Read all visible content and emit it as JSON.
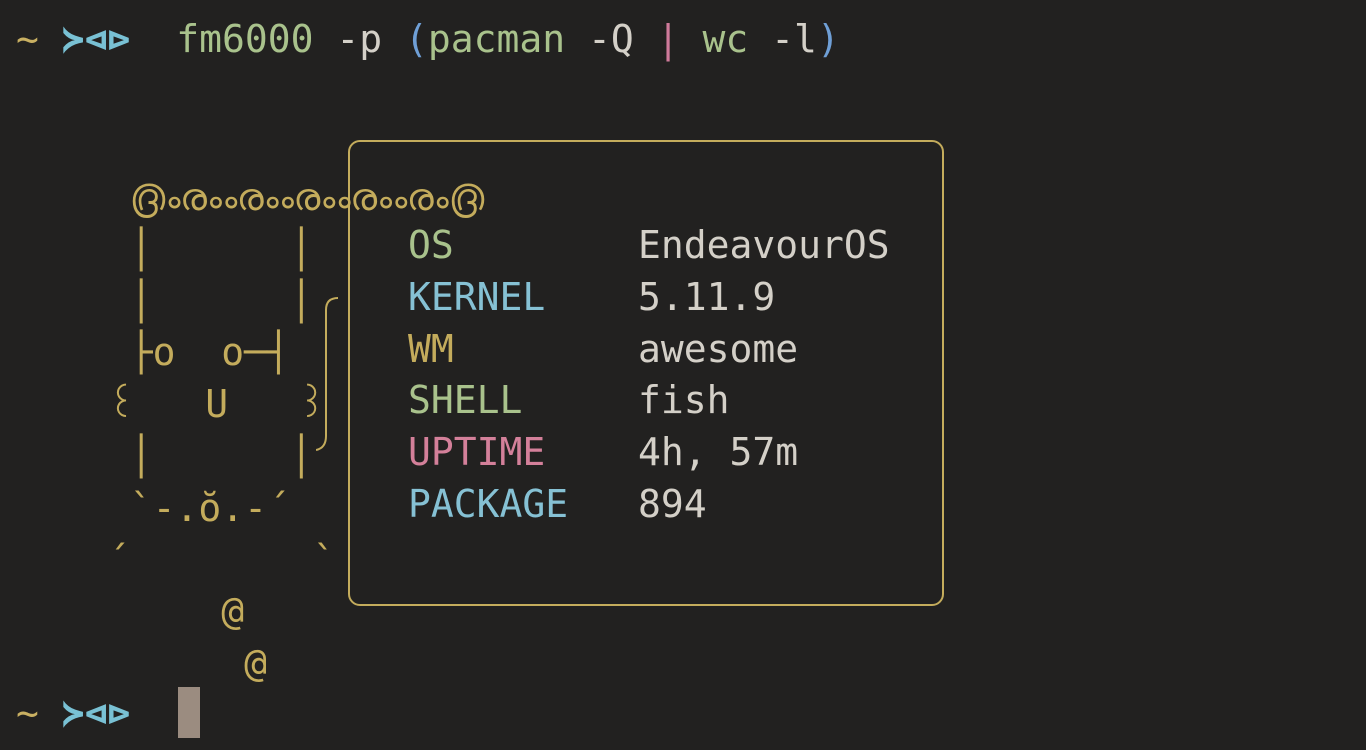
{
  "terminal": {
    "prompt": {
      "tilde": "~",
      "symbol": "≻⊲⊳"
    },
    "command": {
      "program": "fm6000",
      "flag": " -p ",
      "open_paren": "(",
      "sub1": "pacman",
      "sub1_flag": " -Q ",
      "pipe": "|",
      "sub2": " wc",
      "sub2_flag": " -l",
      "close_paren": ")"
    },
    "ascii_art": "  ൫ൟൟൟൟൟ൫\n  │      │\n  │      │\n  ├o  o─┤\n ꒰   U   ꒱\n  │      │\n  `-.ŏ.-´\n ´        `\n      @\n       @",
    "info": [
      {
        "key": "OS",
        "value": "EndeavourOS",
        "color": "#a9c28c"
      },
      {
        "key": "KERNEL",
        "value": "5.11.9",
        "color": "#86c1d4"
      },
      {
        "key": "WM",
        "value": "awesome",
        "color": "#c4ac5c"
      },
      {
        "key": "SHELL",
        "value": "fish",
        "color": "#a9c28c"
      },
      {
        "key": "UPTIME",
        "value": "4h, 57m",
        "color": "#d4809a"
      },
      {
        "key": "PACKAGE",
        "value": "894",
        "color": "#86c1d4"
      }
    ]
  },
  "colors": {
    "background": "#222120",
    "accent": "#c4ac5c",
    "text": "#d4d0c8",
    "cursor": "#9b8c80"
  }
}
